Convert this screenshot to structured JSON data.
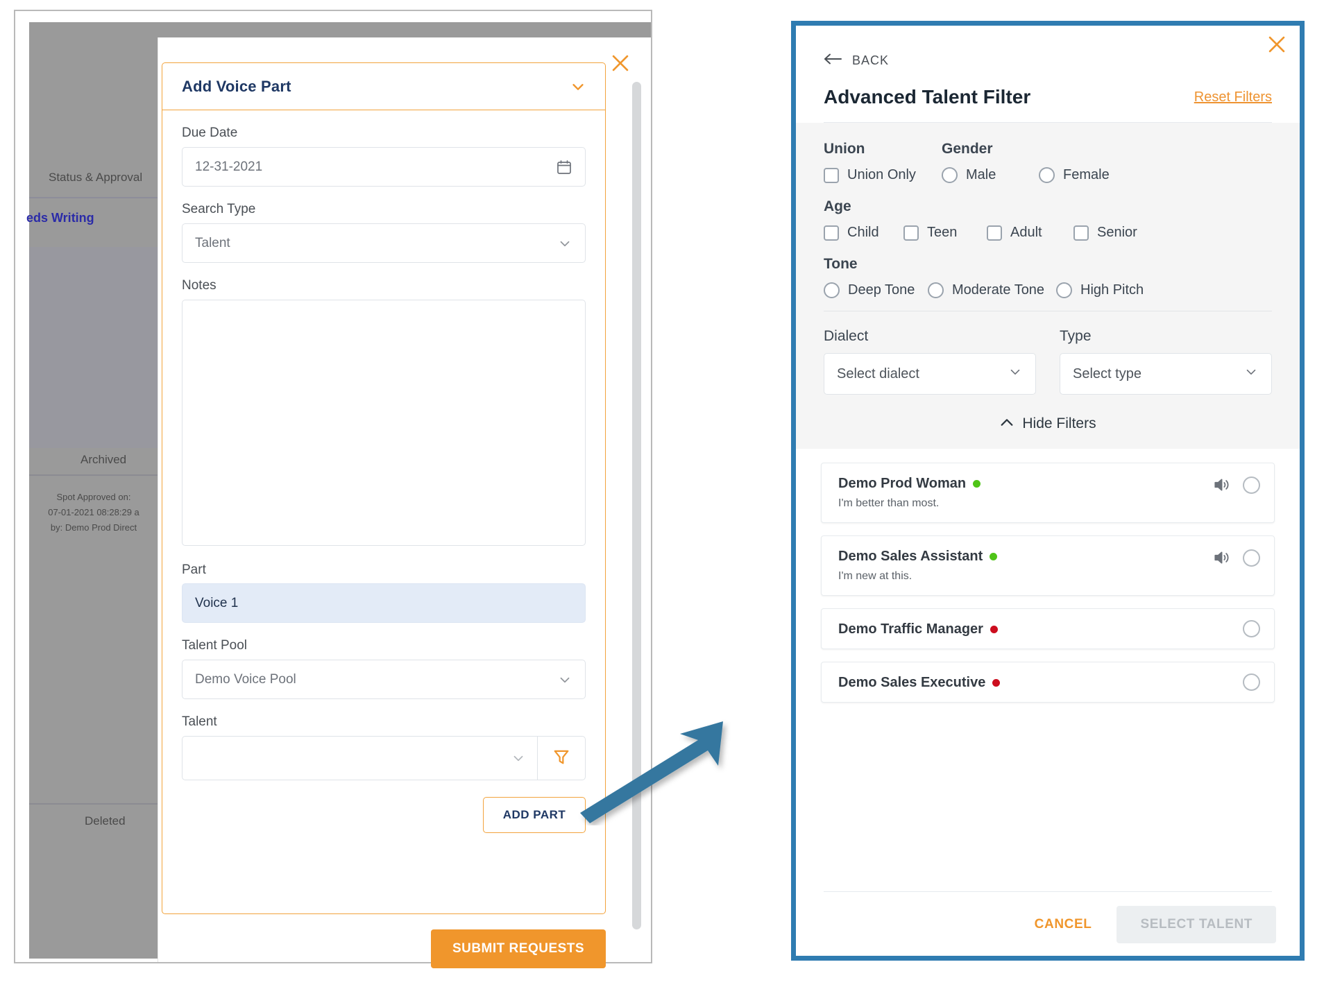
{
  "background_app": {
    "status_approval_label": "Status & Approval",
    "needs_writing_label": "eds Writing",
    "archived_label": "Archived",
    "approved_line1": "Spot Approved on:",
    "approved_line2": "07-01-2021 08:28:29 a",
    "approved_line3": "by: Demo Prod Direct",
    "deleted_label": "Deleted"
  },
  "add_voice_part": {
    "title": "Add Voice Part",
    "collapse_icon": "chevron-down-icon",
    "close_icon": "close-icon",
    "due_date": {
      "label": "Due Date",
      "value": "12-31-2021",
      "icon": "calendar-icon"
    },
    "search_type": {
      "label": "Search Type",
      "value": "Talent",
      "icon": "chevron-down-icon"
    },
    "notes": {
      "label": "Notes",
      "value": ""
    },
    "part": {
      "label": "Part",
      "value": "Voice 1"
    },
    "talent_pool": {
      "label": "Talent Pool",
      "value": "Demo Voice Pool",
      "icon": "chevron-down-icon"
    },
    "talent": {
      "label": "Talent",
      "value": "",
      "dropdown_icon": "chevron-down-icon",
      "filter_icon": "funnel-icon"
    },
    "add_part_label": "ADD PART",
    "submit_label": "SUBMIT REQUESTS"
  },
  "advanced_talent_filter": {
    "back_label": "BACK",
    "back_icon": "arrow-left-icon",
    "close_icon": "close-icon",
    "title": "Advanced Talent Filter",
    "reset_label": "Reset Filters",
    "groups": {
      "union": {
        "title": "Union",
        "options": [
          {
            "label": "Union Only",
            "type": "checkbox",
            "checked": false
          }
        ]
      },
      "gender": {
        "title": "Gender",
        "options": [
          {
            "label": "Male",
            "type": "radio",
            "checked": false
          },
          {
            "label": "Female",
            "type": "radio",
            "checked": false
          }
        ]
      },
      "age": {
        "title": "Age",
        "options": [
          {
            "label": "Child",
            "type": "checkbox",
            "checked": false
          },
          {
            "label": "Teen",
            "type": "checkbox",
            "checked": false
          },
          {
            "label": "Adult",
            "type": "checkbox",
            "checked": false
          },
          {
            "label": "Senior",
            "type": "checkbox",
            "checked": false
          }
        ]
      },
      "tone": {
        "title": "Tone",
        "options": [
          {
            "label": "Deep Tone",
            "type": "radio",
            "checked": false
          },
          {
            "label": "Moderate Tone",
            "type": "radio",
            "checked": false
          },
          {
            "label": "High Pitch",
            "type": "radio",
            "checked": false
          }
        ]
      }
    },
    "dialect": {
      "label": "Dialect",
      "value": "Select dialect",
      "icon": "chevron-down-icon"
    },
    "type": {
      "label": "Type",
      "value": "Select type",
      "icon": "chevron-down-icon"
    },
    "hide_filters_label": "Hide Filters",
    "hide_filters_icon": "chevron-up-icon",
    "talent_list": [
      {
        "name": "Demo Prod Woman",
        "status_color": "#4fc417",
        "tagline": "I'm better than most.",
        "has_audio": true,
        "selected": false
      },
      {
        "name": "Demo Sales Assistant",
        "status_color": "#4fc417",
        "tagline": "I'm new at this.",
        "has_audio": true,
        "selected": false
      },
      {
        "name": "Demo Traffic Manager",
        "status_color": "#cc0d1e",
        "tagline": "",
        "has_audio": false,
        "selected": false
      },
      {
        "name": "Demo Sales Executive",
        "status_color": "#cc0d1e",
        "tagline": "",
        "has_audio": false,
        "selected": false
      }
    ],
    "cancel_label": "CANCEL",
    "select_talent_label": "SELECT TALENT"
  },
  "annotation": {
    "arrow_color": "#36779f",
    "highlight_border_color": "#2f7cb1"
  },
  "colors": {
    "accent_orange": "#f0962c",
    "title_navy": "#1f3864",
    "blue_highlight": "#2f7cb1"
  }
}
